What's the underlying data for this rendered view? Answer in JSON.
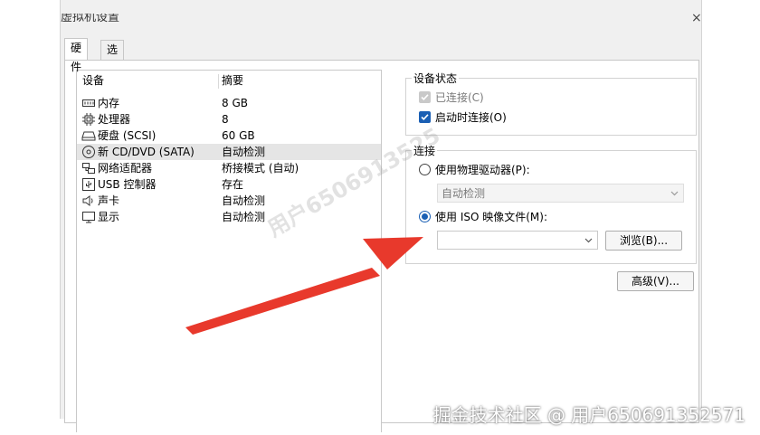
{
  "window": {
    "title": "虚拟机设置",
    "close_glyph": "×"
  },
  "tabs": [
    {
      "label": "硬件",
      "active": true
    },
    {
      "label": "选项",
      "active": false
    }
  ],
  "device_list": {
    "columns": [
      "设备",
      "摘要"
    ],
    "rows": [
      {
        "icon": "memory-icon",
        "name": "内存",
        "summary": "8 GB"
      },
      {
        "icon": "cpu-icon",
        "name": "处理器",
        "summary": "8"
      },
      {
        "icon": "harddisk-icon",
        "name": "硬盘 (SCSI)",
        "summary": "60 GB"
      },
      {
        "icon": "cd-dvd-icon",
        "name": "新 CD/DVD (SATA)",
        "summary": "自动检测",
        "selected": true
      },
      {
        "icon": "network-adapter-icon",
        "name": "网络适配器",
        "summary": "桥接模式 (自动)"
      },
      {
        "icon": "usb-icon",
        "name": "USB 控制器",
        "summary": "存在"
      },
      {
        "icon": "sound-card-icon",
        "name": "声卡",
        "summary": "自动检测"
      },
      {
        "icon": "display-icon",
        "name": "显示",
        "summary": "自动检测"
      }
    ]
  },
  "device_status": {
    "title": "设备状态",
    "connected": {
      "label": "已连接(C)",
      "checked": true,
      "disabled": true
    },
    "connect_at_power_on": {
      "label": "启动时连接(O)",
      "checked": true
    }
  },
  "connection": {
    "title": "连接",
    "physical_drive": {
      "label": "使用物理驱动器(P):",
      "selected": false,
      "value": "自动检测"
    },
    "iso_image": {
      "label": "使用 ISO 映像文件(M):",
      "selected": true,
      "value": ""
    },
    "browse_label": "浏览(B)..."
  },
  "advanced_label": "高级(V)...",
  "watermark": "用户6506913525",
  "footer_credit": "掘金技术社区 @ 用户650691352571",
  "colors": {
    "accent": "#1a5fb4",
    "arrow": "#e8392c"
  }
}
